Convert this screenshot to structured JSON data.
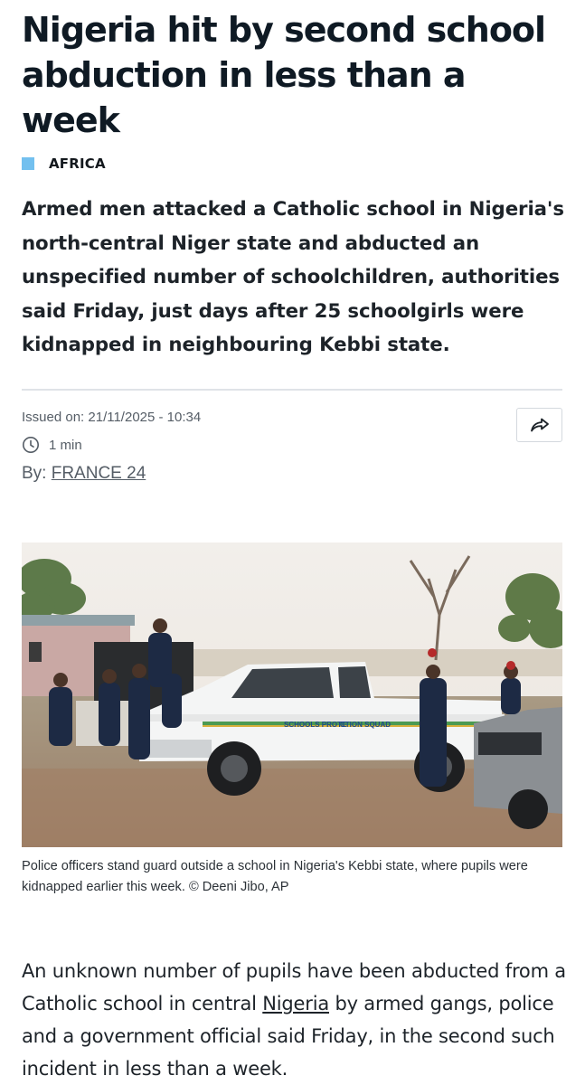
{
  "article": {
    "headline": "Nigeria hit by second school abduction in less than a week",
    "category": "AFRICA",
    "lead": "Armed men attacked a Catholic school in Nigeria's north-central Niger state and abducted an unspecified number of schoolchildren, authorities said Friday, just days after 25 schoolgirls were kidnapped in neighbouring Kebbi state.",
    "issued": "Issued on: 21/11/2025 - 10:34",
    "reading_time": "1 min",
    "byline_prefix": "By: ",
    "byline_author": "FRANCE 24",
    "image": {
      "vehicle_door_text_left": "SCHOOLS PROTE",
      "vehicle_door_text_right": "CTION SQUAD"
    },
    "caption": "Police officers stand guard outside a school in Nigeria's Kebbi state, where pupils were kidnapped earlier this week. © Deeni Jibo, AP",
    "body_before_link": "An unknown number of pupils have been abducted from a Catholic school in central ",
    "body_link": "Nigeria",
    "body_after_link": " by armed gangs, police and a government official said Friday, in the second such incident in less than a week."
  },
  "icons": {
    "clock": "clock-icon",
    "share": "share-icon"
  },
  "colors": {
    "category_accent": "#73c0ef",
    "text_primary": "#13181d",
    "text_meta": "#555d66"
  }
}
